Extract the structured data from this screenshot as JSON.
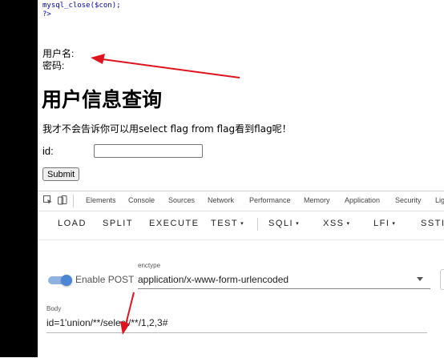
{
  "source_code": {
    "line1_fn": "mysql_close",
    "line1_arg": "($con);",
    "line2": "?>"
  },
  "form_labels": {
    "username": "用户名:",
    "password": "密码:"
  },
  "heading": "用户信息查询",
  "hint": "我才不会告诉你可以用select flag from flag看到flag呢！",
  "id_label": "id:",
  "id_input_value": "",
  "submit_label": "Submit",
  "devtools": {
    "tabs": [
      "Elements",
      "Console",
      "Sources",
      "Network",
      "Performance",
      "Memory",
      "Application",
      "Security",
      "Lig"
    ]
  },
  "hackbar": {
    "buttons": [
      "LOAD",
      "SPLIT",
      "EXECUTE",
      "TEST",
      "SQLI",
      "XSS",
      "LFI",
      "SSTI"
    ],
    "dropdown_caret": "▾",
    "enable_post_label": "Enable POST",
    "enable_post_on": true,
    "enctype_caption": "enctype",
    "enctype_value": "application/x-www-form-urlencoded",
    "body_caption": "Body",
    "body_value": "id=1'union/**/select/**/1,2,3#"
  },
  "colors": {
    "arrow": "#e0141e",
    "toggle_on": "#4a86d4",
    "code_blue": "#0000bb"
  }
}
